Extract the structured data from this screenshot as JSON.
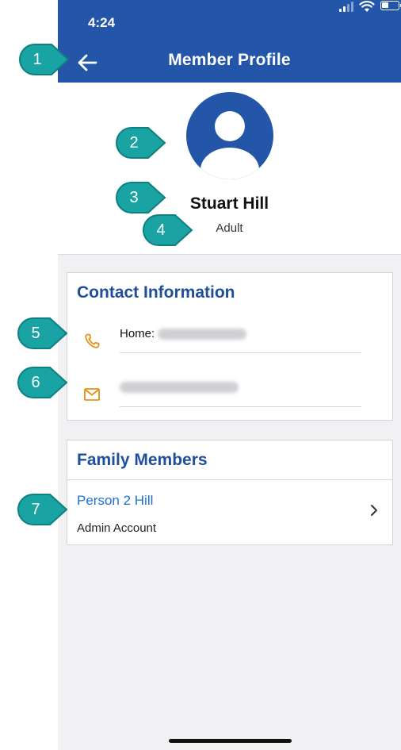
{
  "status_bar": {
    "time": "4:24"
  },
  "header": {
    "title": "Member Profile",
    "back_icon": "arrow-left-icon"
  },
  "profile": {
    "name": "Stuart Hill",
    "member_type": "Adult",
    "avatar_icon": "person-avatar-icon"
  },
  "contact": {
    "title": "Contact Information",
    "phone_label": "Home:",
    "phone_icon": "phone-icon",
    "email_icon": "mail-icon"
  },
  "family": {
    "title": "Family Members",
    "members": [
      {
        "name": "Person 2 Hill",
        "role": "Admin Account"
      }
    ]
  },
  "callouts": [
    "1",
    "2",
    "3",
    "4",
    "5",
    "6",
    "7"
  ],
  "colors": {
    "header": "#2356a8",
    "accent_blue": "#1f4e9a",
    "link_blue": "#1e6fd9",
    "icon_orange": "#e8901a",
    "callout_teal": "#1aa3a3"
  }
}
